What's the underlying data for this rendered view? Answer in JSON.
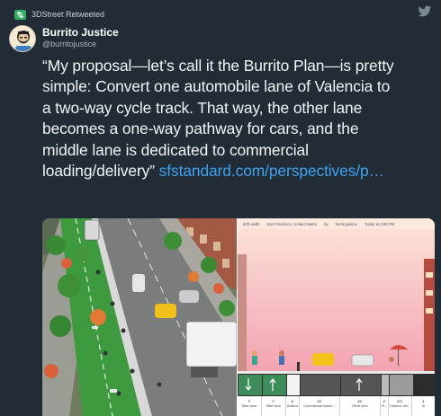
{
  "header": {
    "retweet_text": "3DStreet Retweeted",
    "name": "Burrito Justice",
    "handle": "@burritojustice"
  },
  "tweet": {
    "line1": "“My proposal—let’s call it the Burrito Plan—is pretty",
    "line2": "simple: Convert one automobile lane of Valencia to",
    "line3": "a two-way cycle track. That way, the other lane",
    "line4": "becomes a one-way pathway for cars, and the",
    "line5": "middle lane is dedicated to commercial",
    "line6_text": "loading/delivery”",
    "link": "sfstandard.com/perspectives/p…"
  },
  "screenshot_ui": {
    "width": "82ft width",
    "location": "San Francisco, United States",
    "by": "by",
    "author": "burritojustice",
    "date": "Today at 2:50 PM"
  },
  "lanes": [
    {
      "w": "7'",
      "label": "Bike lane"
    },
    {
      "w": "7'",
      "label": "Bike lane"
    },
    {
      "w": "4'",
      "label": "Bollard"
    },
    {
      "w": "10'",
      "label": "Commercial loadin..."
    },
    {
      "w": "10'",
      "label": "Drive lane"
    },
    {
      "w": "2'",
      "label": "Pl..."
    },
    {
      "w": "6½'",
      "label": "Outdoor din..."
    },
    {
      "w": "1",
      "label": "Si"
    }
  ],
  "colors": {
    "background": "#212c36",
    "link": "#3ea2ef",
    "retweet_icon": "#2fae62"
  },
  "icons": [
    "retweet-icon",
    "twitter-bird-icon"
  ]
}
